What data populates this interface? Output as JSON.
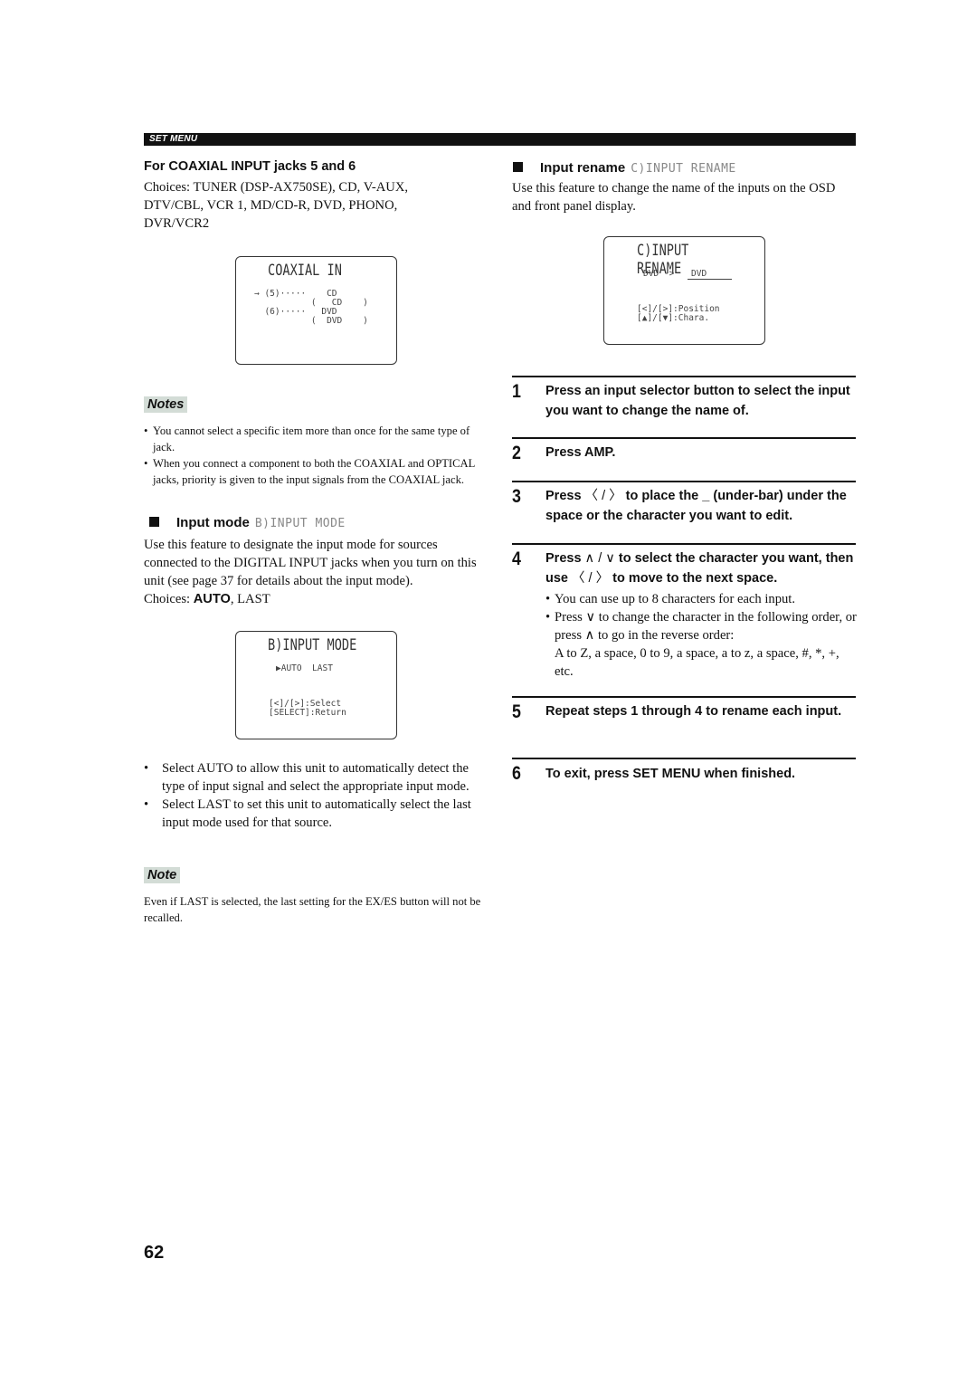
{
  "header": {
    "section_label": "SET MENU"
  },
  "left": {
    "coaxial": {
      "heading": "For COAXIAL INPUT jacks 5 and 6",
      "choices": [
        "Choices: TUNER (DSP-AX750SE), CD, V-AUX,",
        "DTV/CBL, VCR 1, MD/CD-R, DVD, PHONO,",
        "DVR/VCR2"
      ],
      "osd": {
        "title": "COAXIAL IN",
        "rows": [
          "→ (5)·····    CD",
          "           (   CD    )",
          "  (6)·····   DVD",
          "           (  DVD    )"
        ]
      }
    },
    "notes": {
      "label": "Notes",
      "items": [
        "You cannot select a specific item more than once for the same type of jack.",
        "When you connect a component to both the COAXIAL and OPTICAL jacks, priority is given to the input signals from the COAXIAL jack."
      ]
    },
    "input_mode": {
      "heading": "Input mode",
      "lcd": "B)INPUT MODE",
      "description": "Use this feature to designate the input mode for sources connected to the DIGITAL INPUT jacks when you turn on this unit (see page 37 for details about the input mode).",
      "choices_prefix": "Choices: ",
      "choices_default": "AUTO",
      "choices_rest": ", LAST",
      "osd": {
        "title": "B)INPUT MODE",
        "options": "▶AUTO  LAST",
        "help": [
          "[<]/[>]:Select",
          "[SELECT]:Return"
        ]
      },
      "bullets": [
        "Select AUTO to allow this unit to automatically detect the type of input signal and select the appropriate input mode.",
        "Select LAST to set this unit to automatically select the last input mode used for that source."
      ]
    },
    "note": {
      "label": "Note",
      "text": "Even if LAST is selected, the last setting for the EX/ES button will not be recalled."
    }
  },
  "right": {
    "input_rename": {
      "heading": "Input rename",
      "lcd": "C)INPUT RENAME",
      "description": "Use this feature to change the name of the inputs on the OSD and front panel display.",
      "osd": {
        "title": "C)INPUT RENAME",
        "rename_from": "DVD ->",
        "rename_to": "DVD",
        "help": [
          "[<]/[>]:Position",
          "[▲]/[▼]:Chara."
        ]
      }
    },
    "steps": [
      {
        "num": "1",
        "text": "Press an input selector button to select the input you want to change the name of."
      },
      {
        "num": "2",
        "text": "Press AMP."
      },
      {
        "num": "3",
        "text_a": "Press ",
        "text_b": " to place the _ (under-bar) under the space or the character you want to edit."
      },
      {
        "num": "4",
        "text_a": "Press ",
        "text_b": " to select the character you want, then use ",
        "text_c": " to move to the next space."
      },
      {
        "num": "5",
        "text": "Repeat steps 1 through 4 to rename each input."
      },
      {
        "num": "6",
        "text": "To exit, press SET MENU when finished."
      }
    ],
    "step4_bullets": {
      "b1": "You can use up to 8 characters for each input.",
      "b2_a": "Press ",
      "b2_b": " to change the character in the following order, or press ",
      "b2_c": " to go in the reverse order:",
      "b2_d": "A to Z, a space, 0 to 9, a space, a to z, a space, #, *, +, etc."
    },
    "icons": {
      "left_right": "〈 / 〉",
      "up_down": "∧ / ∨",
      "down": "∨",
      "up": "∧"
    }
  },
  "footer": {
    "page_number": "62"
  }
}
